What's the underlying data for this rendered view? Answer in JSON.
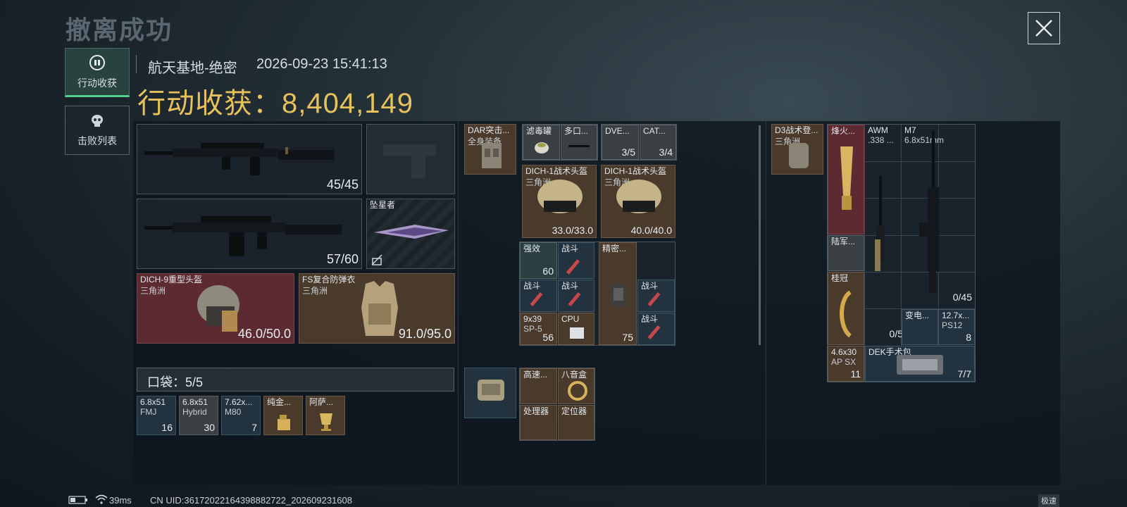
{
  "page_title": "撤离成功",
  "nav": [
    {
      "label": "行动收获",
      "icon": "operator-logo-icon",
      "active": true
    },
    {
      "label": "击败列表",
      "icon": "skull-icon",
      "active": false
    }
  ],
  "header": {
    "map_name": "航天基地-绝密",
    "datetime": "2026-09-23 15:41:13",
    "harvest_label": "行动收获：",
    "harvest_value": "8,404,149"
  },
  "equipment": {
    "primary_weapon": {
      "ammo": "45/45"
    },
    "secondary_weapon": {
      "ammo": "57/60"
    },
    "melee": {
      "name": "坠星者"
    },
    "helmet": {
      "name": "DICH-9重型头盔",
      "faction": "三角洲",
      "durability": "46.0/50.0"
    },
    "armor": {
      "name": "FS复合防弹衣",
      "faction": "三角洲",
      "durability": "91.0/95.0"
    }
  },
  "pocket": {
    "label": "口袋：",
    "count": "5/5",
    "items": [
      {
        "name": "6.8x51",
        "sub": "FMJ",
        "qty": "16"
      },
      {
        "name": "6.8x51",
        "sub": "Hybrid",
        "qty": "30"
      },
      {
        "name": "7.62x...",
        "sub": "M80",
        "qty": "7"
      },
      {
        "name": "纯金...",
        "sub": "",
        "qty": ""
      },
      {
        "name": "阿萨...",
        "sub": "",
        "qty": ""
      }
    ]
  },
  "chest_rig": {
    "name": "DAR突击...",
    "sub": "全身装备",
    "items": {
      "filter": "滤毒罐",
      "multi": "多口...",
      "dve": {
        "name": "DVE...",
        "count": "3/5"
      },
      "cat": {
        "name": "CAT...",
        "count": "3/4"
      },
      "helmet1": {
        "name": "DICH-1战术头盔",
        "faction": "三角洲",
        "durability": "33.0/33.0"
      },
      "helmet2": {
        "name": "DICH-1战术头盔",
        "faction": "三角洲",
        "durability": "40.0/40.0"
      },
      "strong": {
        "name": "强效",
        "qty": "60"
      },
      "zhandou": "战斗",
      "jingmi": "精密...",
      "ammo939": {
        "name": "9x39",
        "sub": "SP-5",
        "qty": "56"
      },
      "cpu": "CPU",
      "misc_qty": "75"
    }
  },
  "pouch": {
    "items": [
      "高速...",
      "八音盒",
      "处理器",
      "定位器"
    ]
  },
  "backpack": {
    "name": "D3战术登...",
    "sub": "三角洲",
    "items": {
      "fire": "烽火...",
      "awm": {
        "name": "AWM",
        "sub": ".338 ..."
      },
      "m7": {
        "name": "M7",
        "sub": "6.8x51mm"
      },
      "luzhi": "陆军...",
      "guiguan": "桂冠",
      "awm_ammo": "0/5",
      "m7_ammo": "0/45",
      "bianpin": "变电...",
      "ammo127": {
        "name": "12.7x...",
        "sub": "PS12",
        "qty": "8"
      },
      "ammo46": {
        "name": "4.6x30",
        "sub": "AP SX",
        "qty": "11"
      },
      "dek": {
        "name": "DEK手术包",
        "count": "7/7"
      }
    }
  },
  "status_bar": {
    "ping": "39ms",
    "uid": "CN UID:36172022164398882722_202609231608",
    "speed": "极速"
  }
}
